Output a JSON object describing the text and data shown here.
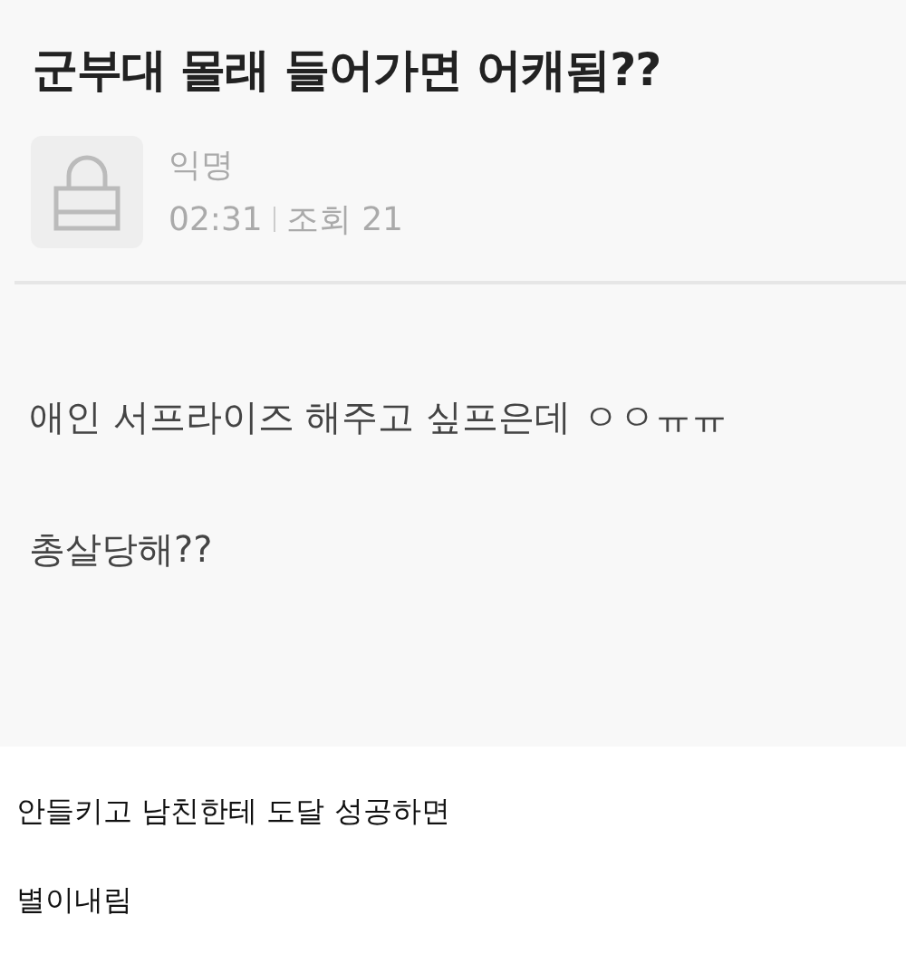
{
  "post": {
    "title": "군부대 몰래 들어가면 어캐됨??",
    "author": "익명",
    "time": "02:31",
    "views": "조회 21",
    "body": [
      "애인 서프라이즈 해주고 싶프은데 ㅇㅇㅠㅠ",
      "총살당해??"
    ]
  },
  "caption": [
    "안들키고 남친한테 도달 성공하면",
    "별이내림"
  ]
}
